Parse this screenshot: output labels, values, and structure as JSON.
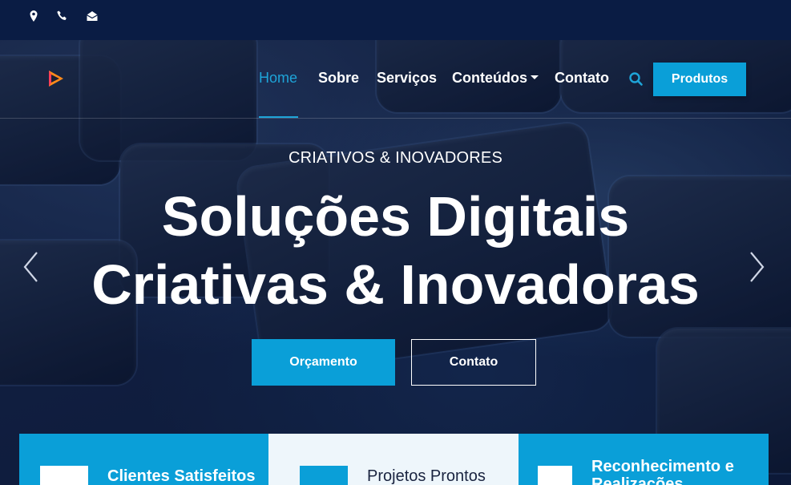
{
  "topbar": {
    "icons": [
      "map-pin-icon",
      "phone-icon",
      "envelope-open-icon"
    ]
  },
  "nav": {
    "items": [
      {
        "label": "Home",
        "active": true
      },
      {
        "label": "Sobre"
      },
      {
        "label": "Serviços"
      },
      {
        "label": "Conteúdos",
        "dropdown": true
      },
      {
        "label": "Contato"
      }
    ],
    "cta_label": "Produtos"
  },
  "hero": {
    "subtitle": "CRIATIVOS & INOVADORES",
    "headline_line1": "Soluções Digitais",
    "headline_line2": "Criativas & Inovadoras",
    "primary_button": "Orçamento",
    "secondary_button": "Contato"
  },
  "features": [
    {
      "label": "Clientes Satisfeitos"
    },
    {
      "label": "Projetos Prontos"
    },
    {
      "label": "Reconhecimento e Realizações"
    }
  ],
  "colors": {
    "accent": "#0a9fd8",
    "topbar": "#0a1c44",
    "feature_light": "#eef6fb"
  }
}
